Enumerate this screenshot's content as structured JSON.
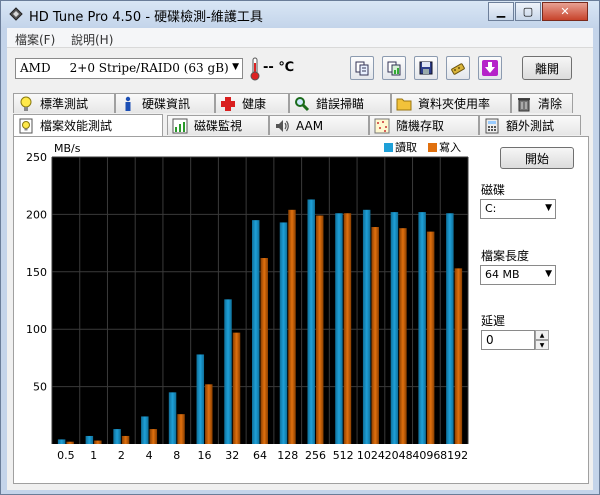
{
  "window": {
    "title": "HD Tune Pro 4.50 - 硬碟檢測-維護工具"
  },
  "menu": [
    "檔案(F)",
    "說明(H)"
  ],
  "toolbar": {
    "drive": "AMD     2+0 Stripe/RAID0 (63 gB)",
    "temperature": "-- ℃",
    "exit_label": "離開",
    "buttons": [
      "copy-text-icon",
      "copy-screenshot-icon",
      "save-icon",
      "options-icon",
      "download-icon"
    ]
  },
  "tabs_top": [
    {
      "label": "標準測試",
      "icon": "bulb-icon"
    },
    {
      "label": "硬碟資訊",
      "icon": "info-icon"
    },
    {
      "label": "健康",
      "icon": "health-cross-icon"
    },
    {
      "label": "錯誤掃瞄",
      "icon": "magnifier-icon"
    },
    {
      "label": "資料夾使用率",
      "icon": "folder-icon"
    },
    {
      "label": "清除",
      "icon": "trash-icon"
    }
  ],
  "tabs_bottom": [
    {
      "label": "檔案效能測試",
      "icon": "file-bulb-icon",
      "active": true
    },
    {
      "label": "磁碟監視",
      "icon": "monitor-chart-icon"
    },
    {
      "label": "AAM",
      "icon": "speaker-icon"
    },
    {
      "label": "隨機存取",
      "icon": "random-icon"
    },
    {
      "label": "額外測試",
      "icon": "calculator-icon"
    }
  ],
  "side": {
    "start_label": "開始",
    "disk_label": "磁碟",
    "disk_value": "C:",
    "file_length_label": "檔案長度",
    "file_length_value": "64 MB",
    "delay_label": "延遲",
    "delay_value": "0"
  },
  "chart_data": {
    "type": "bar",
    "ylabel": "MB/s",
    "ylim": [
      0,
      250
    ],
    "yticks": [
      50,
      100,
      150,
      200,
      250
    ],
    "grid": true,
    "legend_position": "top-right",
    "categories": [
      "0.5",
      "1",
      "2",
      "4",
      "8",
      "16",
      "32",
      "64",
      "128",
      "256",
      "512",
      "1024",
      "2048",
      "4096",
      "8192"
    ],
    "series": [
      {
        "name": "讀取",
        "color": "#1ea0d8",
        "values": [
          4,
          7,
          13,
          24,
          45,
          78,
          126,
          195,
          193,
          213,
          201,
          204,
          202,
          202,
          201
        ]
      },
      {
        "name": "寫入",
        "color": "#e0700e",
        "values": [
          2,
          3,
          7,
          13,
          26,
          52,
          97,
          162,
          204,
          199,
          201,
          189,
          188,
          185,
          153
        ]
      }
    ]
  }
}
